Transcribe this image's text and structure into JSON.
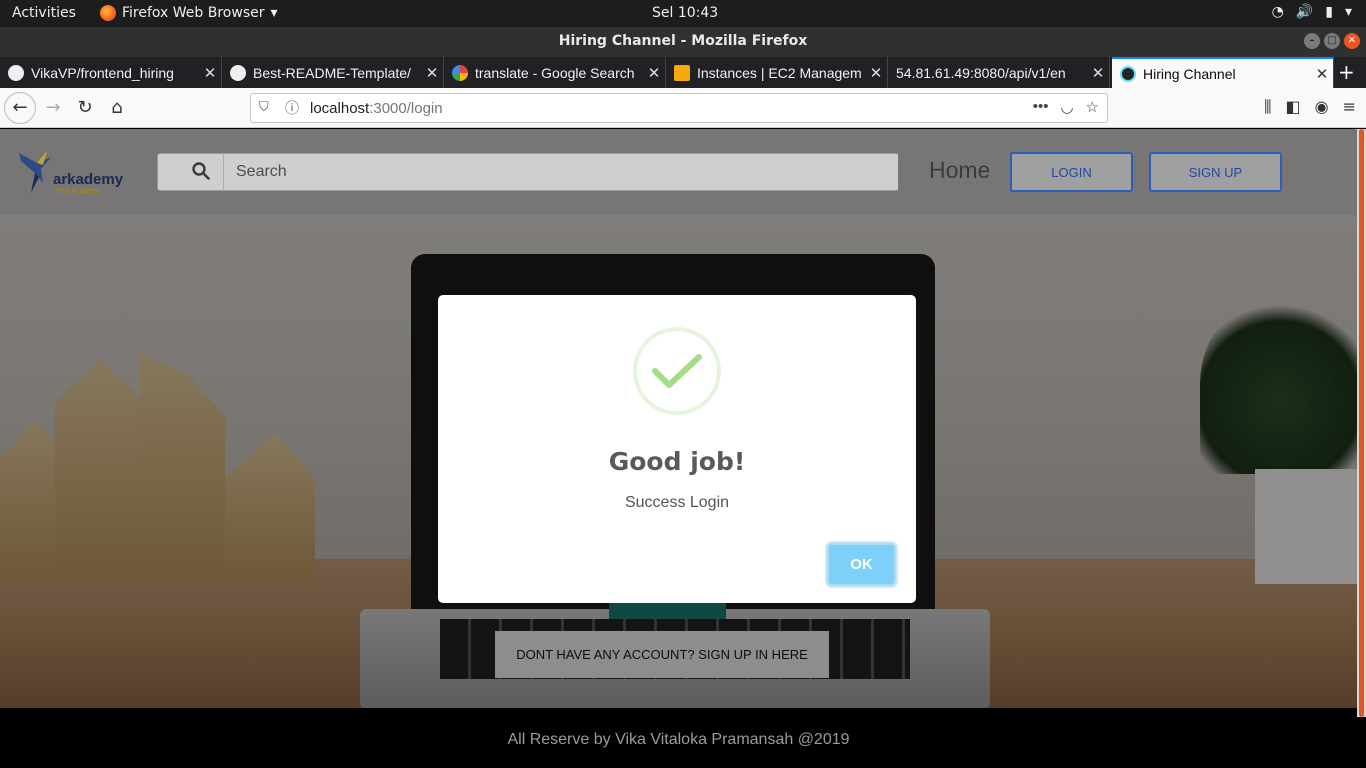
{
  "system": {
    "activities": "Activities",
    "app_name": "Firefox Web Browser",
    "clock": "Sel 10:43"
  },
  "window": {
    "title": "Hiring Channel - Mozilla Firefox"
  },
  "tabs": [
    {
      "label": "VikaVP/frontend_hiring",
      "favicon": "github-icon"
    },
    {
      "label": "Best-README-Template/",
      "favicon": "github-icon"
    },
    {
      "label": "translate - Google Search",
      "favicon": "google-icon"
    },
    {
      "label": "Instances | EC2 Managem",
      "favicon": "aws-icon"
    },
    {
      "label": "54.81.61.49:8080/api/v1/en",
      "favicon": "none"
    },
    {
      "label": "Hiring Channel",
      "favicon": "react-icon",
      "active": true
    }
  ],
  "urlbar": {
    "host": "localhost",
    "path": ":3000/login"
  },
  "site": {
    "logo_brand": "arkademy",
    "logo_tagline": "Tech Academy",
    "search_placeholder": "Search",
    "nav_home": "Home",
    "login_button": "LOGIN",
    "signup_button": "SIGN UP",
    "signup_prompt": "DONT HAVE ANY ACCOUNT? SIGN UP IN HERE",
    "footer": "All Reserve by Vika Vitaloka Pramansah @2019"
  },
  "modal": {
    "title": "Good job!",
    "text": "Success Login",
    "ok_label": "OK",
    "accent_color": "#a5dc86",
    "button_color": "#7cd1f9"
  }
}
